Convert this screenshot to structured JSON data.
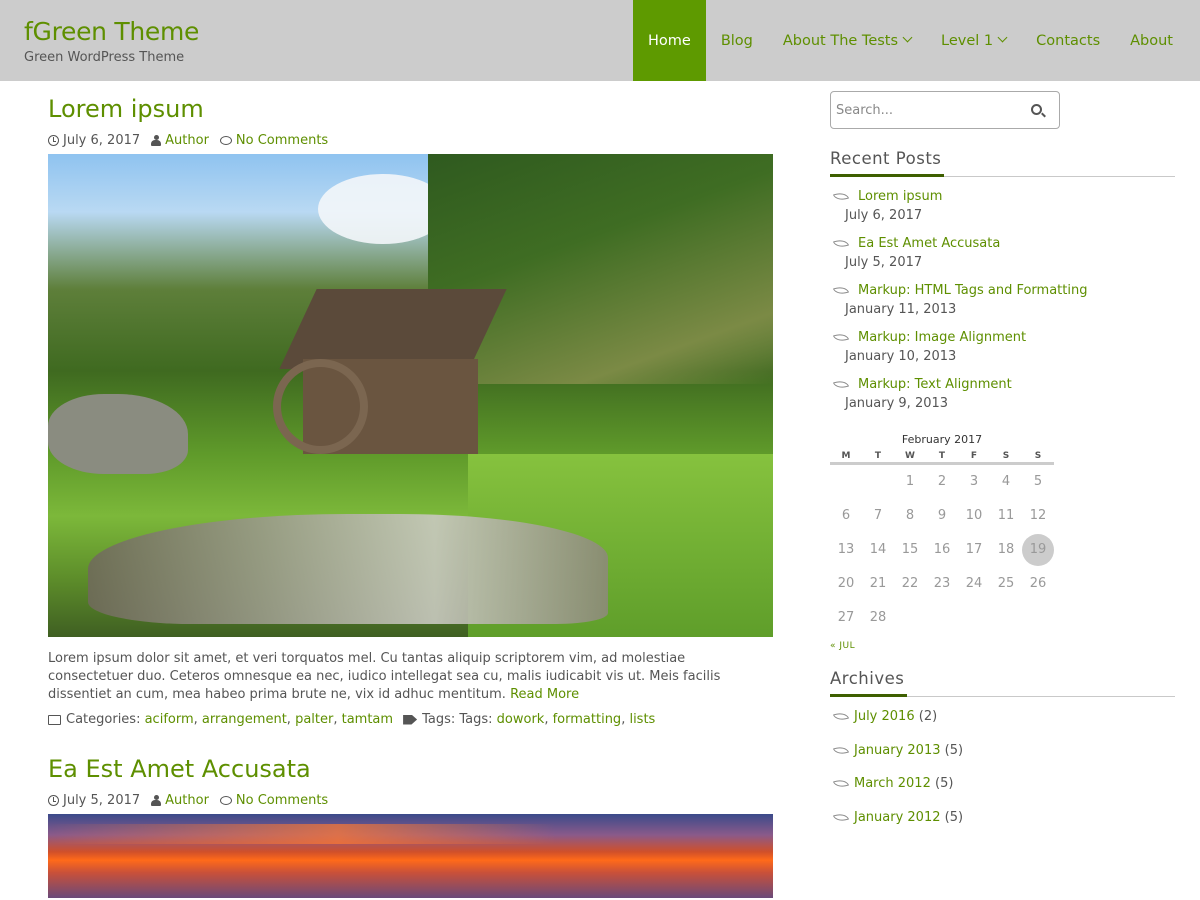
{
  "site": {
    "title": "fGreen Theme",
    "description": "Green WordPress Theme"
  },
  "nav": {
    "items": [
      {
        "label": "Home",
        "active": true,
        "has_submenu": false
      },
      {
        "label": "Blog",
        "active": false,
        "has_submenu": false
      },
      {
        "label": "About The Tests",
        "active": false,
        "has_submenu": true
      },
      {
        "label": "Level 1",
        "active": false,
        "has_submenu": true
      },
      {
        "label": "Contacts",
        "active": false,
        "has_submenu": false
      },
      {
        "label": "About",
        "active": false,
        "has_submenu": false
      }
    ]
  },
  "posts": [
    {
      "title": "Lorem ipsum",
      "date": "July 6, 2017",
      "author": "Author",
      "comments": "No Comments",
      "excerpt": "Lorem ipsum dolor sit amet, et veri torquatos mel. Cu tantas aliquip scriptorem vim, ad molestiae consectetuer duo. Ceteros omnesque ea nec, iudico intellegat sea cu, malis iudicabit vis ut. Meis facilis dissentiet an cum, mea habeo prima brute ne, vix id adhuc mentitum.",
      "read_more": "Read More",
      "categories_label": "Categories:",
      "categories": [
        "aciform",
        "arrangement",
        "palter",
        "tamtam"
      ],
      "tags_label": "Tags: Tags:",
      "tags": [
        "dowork",
        "formatting",
        "lists"
      ]
    },
    {
      "title": "Ea Est Amet Accusata",
      "date": "July 5, 2017",
      "author": "Author",
      "comments": "No Comments"
    }
  ],
  "sidebar": {
    "search_placeholder": "Search...",
    "recent_title": "Recent Posts",
    "recent": [
      {
        "title": "Lorem ipsum",
        "date": "July 6, 2017"
      },
      {
        "title": "Ea Est Amet Accusata",
        "date": "July 5, 2017"
      },
      {
        "title": "Markup: HTML Tags and Formatting",
        "date": "January 11, 2013"
      },
      {
        "title": "Markup: Image Alignment",
        "date": "January 10, 2013"
      },
      {
        "title": "Markup: Text Alignment",
        "date": "January 9, 2013"
      }
    ],
    "calendar": {
      "caption": "February 2017",
      "days": [
        "M",
        "T",
        "W",
        "T",
        "F",
        "S",
        "S"
      ],
      "weeks": [
        [
          "",
          "",
          "1",
          "2",
          "3",
          "4",
          "5"
        ],
        [
          "6",
          "7",
          "8",
          "9",
          "10",
          "11",
          "12"
        ],
        [
          "13",
          "14",
          "15",
          "16",
          "17",
          "18",
          "19"
        ],
        [
          "20",
          "21",
          "22",
          "23",
          "24",
          "25",
          "26"
        ],
        [
          "27",
          "28",
          "",
          "",
          "",
          "",
          ""
        ]
      ],
      "today": "19",
      "prev": "« JUL"
    },
    "archives_title": "Archives",
    "archives": [
      {
        "label": "July 2016",
        "count": "(2)"
      },
      {
        "label": "January 2013",
        "count": "(5)"
      },
      {
        "label": "March 2012",
        "count": "(5)"
      },
      {
        "label": "January 2012",
        "count": "(5)"
      }
    ]
  },
  "colors": {
    "accent": "#5e8f00",
    "header_bg": "#cccccc",
    "nav_active_bg": "#5e9a00"
  }
}
